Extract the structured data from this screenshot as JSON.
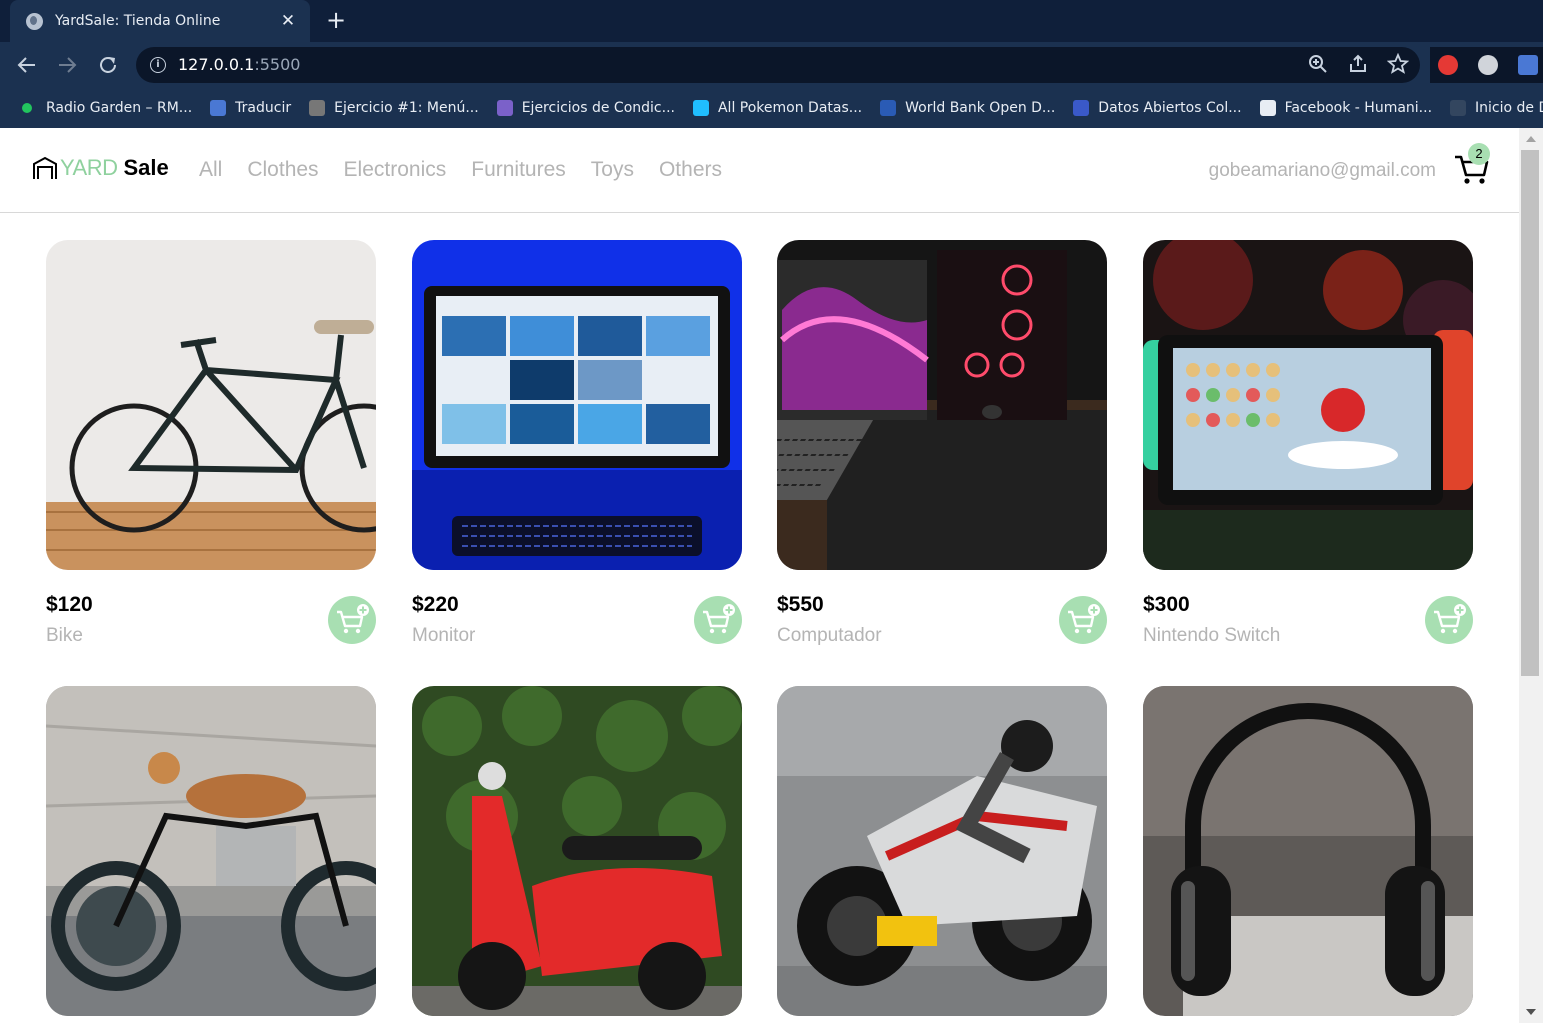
{
  "browser": {
    "tab_title": "YardSale: Tienda Online",
    "tab_close": "✕",
    "new_tab": "+",
    "url_host": "127.0.0.1",
    "url_port": ":5500",
    "bookmarks": [
      {
        "label": "Radio Garden – RM...",
        "icon": "radio-garden-icon",
        "color": "#22c55e"
      },
      {
        "label": "Traducir",
        "icon": "google-translate-icon",
        "color": "#4a78d4"
      },
      {
        "label": "Ejercicio #1: Menú...",
        "icon": "ejercicio-icon",
        "color": "#777777"
      },
      {
        "label": "Ejercicios de Condic...",
        "icon": "ejercicios-icon",
        "color": "#7b61c9"
      },
      {
        "label": "All Pokemon Datas...",
        "icon": "kaggle-icon",
        "color": "#20beff"
      },
      {
        "label": "World Bank Open D...",
        "icon": "world-bank-icon",
        "color": "#2a5bb5"
      },
      {
        "label": "Datos Abiertos Col...",
        "icon": "datos-abiertos-icon",
        "color": "#3a59c9"
      },
      {
        "label": "Facebook - Humani...",
        "icon": "facebook-humani-icon",
        "color": "#e8edf4"
      },
      {
        "label": "Inicio de D",
        "icon": "fb-icon",
        "color": "#33465f"
      }
    ]
  },
  "header": {
    "logo_yard": "YARD",
    "logo_sale": "Sale",
    "nav": [
      "All",
      "Clothes",
      "Electronics",
      "Furnitures",
      "Toys",
      "Others"
    ],
    "email": "gobeamariano@gmail.com",
    "cart_count": "2"
  },
  "products": [
    {
      "price": "$120",
      "name": "Bike",
      "image": "bicycle"
    },
    {
      "price": "$220",
      "name": "Monitor",
      "image": "monitor"
    },
    {
      "price": "$550",
      "name": "Computador",
      "image": "computer-setup"
    },
    {
      "price": "$300",
      "name": "Nintendo Switch",
      "image": "nintendo-switch"
    },
    {
      "price": "",
      "name": "",
      "image": "motorcycle"
    },
    {
      "price": "",
      "name": "",
      "image": "scooter"
    },
    {
      "price": "",
      "name": "",
      "image": "sport-bike"
    },
    {
      "price": "",
      "name": "",
      "image": "headphones"
    }
  ],
  "colors": {
    "accent": "#a8dfb2",
    "logo_green": "#8fd19e",
    "muted_text": "#b4b4b4",
    "chrome_dark": "#0f1f3a",
    "chrome": "#1b3150"
  }
}
